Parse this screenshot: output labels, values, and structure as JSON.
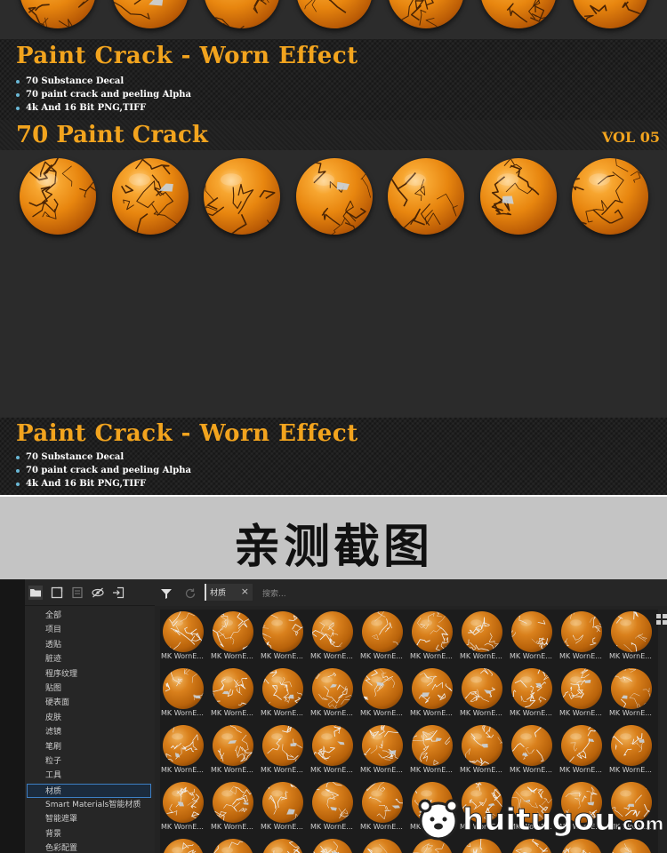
{
  "banner_top": {
    "title": "Paint Crack - Worn Effect",
    "bullets": [
      "70 Substance Decal",
      "70 paint crack and peeling Alpha",
      "4k And 16 Bit PNG,TIFF"
    ]
  },
  "volume_header": {
    "title": "70 Paint Crack",
    "volume": "VOL 05"
  },
  "banner_bottom": {
    "title": "Paint Crack - Worn Effect",
    "bullets": [
      "70 Substance Decal",
      "70 paint crack and peeling Alpha",
      "4k And 16 Bit PNG,TIFF"
    ]
  },
  "screenshot_section": {
    "title": "亲测截图"
  },
  "app": {
    "sidebar": {
      "tool_icons": [
        "folder-icon",
        "new-window-icon",
        "save-icon",
        "hide-icon",
        "import-icon"
      ],
      "categories": [
        {
          "label": "全部"
        },
        {
          "label": "项目"
        },
        {
          "label": "透贴"
        },
        {
          "label": "脏迹"
        },
        {
          "label": "程序纹理"
        },
        {
          "label": "贴图"
        },
        {
          "label": "硬表面"
        },
        {
          "label": "皮肤"
        },
        {
          "label": "滤镜"
        },
        {
          "label": "笔刷"
        },
        {
          "label": "粒子"
        },
        {
          "label": "工具"
        },
        {
          "label": "材质",
          "selected": true
        },
        {
          "label": "Smart Materials智能材质"
        },
        {
          "label": "智能遮罩"
        },
        {
          "label": "背景"
        },
        {
          "label": "色彩配置"
        }
      ]
    },
    "toolbar": {
      "filter_icon": "filter-icon",
      "refresh_icon": "refresh-icon",
      "filter_tag": "材质",
      "filter_tag_close": "×",
      "search_placeholder": "搜索..."
    },
    "asset_label": "MK WornE...",
    "view_icon": "grid-view-icon"
  },
  "watermark": {
    "logo_icon": "bear-logo-icon",
    "text": "huitugou",
    "suffix": ".com"
  },
  "colors": {
    "accent_orange": "#f2a41e",
    "selection_blue": "#3d7fc4",
    "bullet_dot": "#6ab8d6"
  }
}
